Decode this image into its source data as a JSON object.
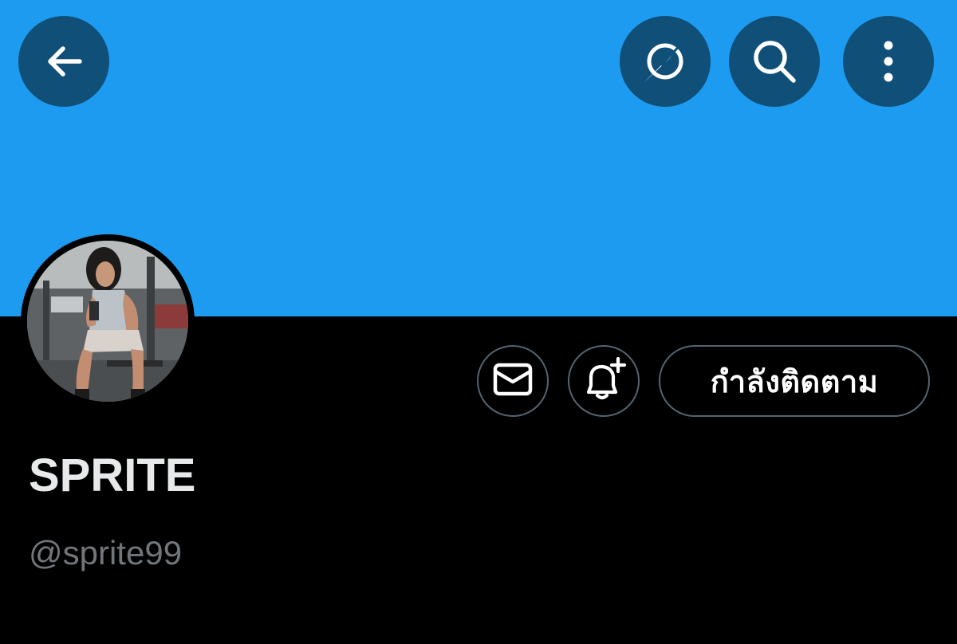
{
  "header": {
    "banner_color": "#1d9bf0",
    "buttons": [
      {
        "name": "back-icon"
      },
      {
        "name": "translate-off-icon"
      },
      {
        "name": "search-icon"
      },
      {
        "name": "more-vertical-icon"
      }
    ]
  },
  "profile": {
    "display_name": "SPRITE",
    "handle": "@sprite99",
    "avatar": "avatar-photo"
  },
  "actions": {
    "message_icon": "envelope-icon",
    "notify_icon": "bell-plus-icon",
    "following_label": "กำลังติดตาม"
  },
  "colors": {
    "background": "#000000",
    "accent": "#1d9bf0",
    "button_overlay": "#0f4f78",
    "border": "#536471",
    "primary_text": "#e7e9ea",
    "secondary_text": "#71767b"
  }
}
